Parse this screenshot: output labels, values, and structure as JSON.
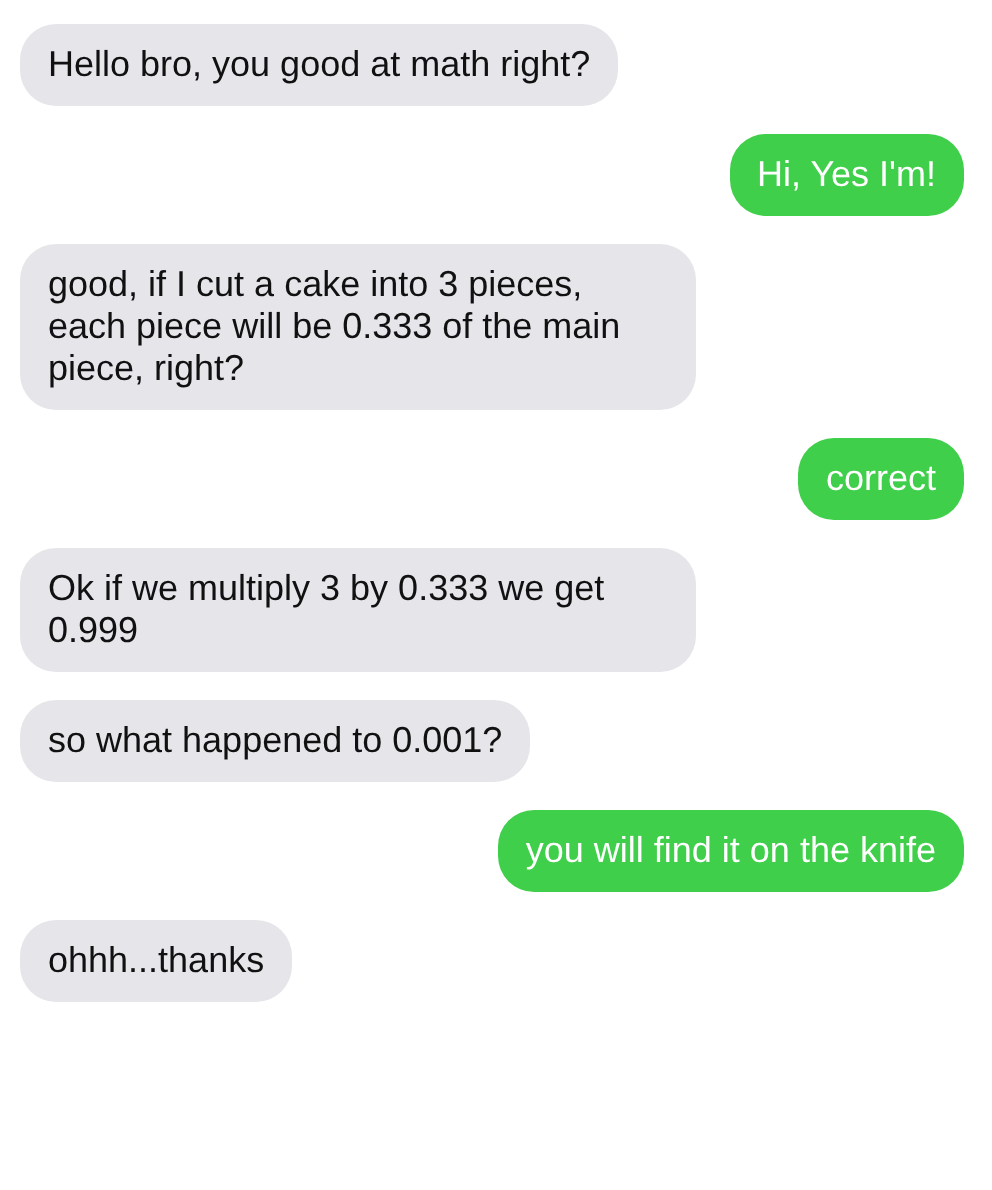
{
  "messages": [
    {
      "kind": "received",
      "text": "Hello bro, you good at math right?"
    },
    {
      "kind": "sent",
      "text": "Hi, Yes I'm!"
    },
    {
      "kind": "received",
      "text": "good, if I cut a cake into 3 pieces, each piece will be 0.333 of the main piece, right?"
    },
    {
      "kind": "sent",
      "text": "correct"
    },
    {
      "kind": "received",
      "text": "Ok if we multiply 3 by 0.333 we get 0.999"
    },
    {
      "kind": "received",
      "text": "so what happened to 0.001?"
    },
    {
      "kind": "sent",
      "text": "you will find it on the knife"
    },
    {
      "kind": "received",
      "text": "ohhh...thanks"
    }
  ]
}
